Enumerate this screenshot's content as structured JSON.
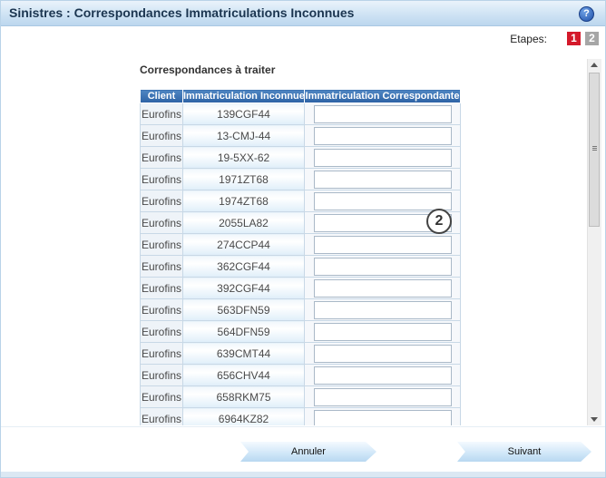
{
  "window": {
    "title": "Sinistres : Correspondances Immatriculations Inconnues",
    "help_icon": "?"
  },
  "steps": {
    "label": "Etapes:",
    "items": [
      {
        "label": "1",
        "color": "#d4192a"
      },
      {
        "label": "2",
        "color": "#a6a6a6"
      }
    ]
  },
  "section": {
    "title": "Correspondances à traiter"
  },
  "table": {
    "headers": [
      "Client",
      "Immatriculation Inconnue",
      "Immatriculation Correspondante"
    ],
    "rows": [
      {
        "client": "Eurofins",
        "plate": "139CGF44",
        "match": ""
      },
      {
        "client": "Eurofins",
        "plate": "13-CMJ-44",
        "match": ""
      },
      {
        "client": "Eurofins",
        "plate": "19-5XX-62",
        "match": ""
      },
      {
        "client": "Eurofins",
        "plate": "1971ZT68",
        "match": ""
      },
      {
        "client": "Eurofins",
        "plate": "1974ZT68",
        "match": ""
      },
      {
        "client": "Eurofins",
        "plate": "2055LA82",
        "match": ""
      },
      {
        "client": "Eurofins",
        "plate": "274CCP44",
        "match": ""
      },
      {
        "client": "Eurofins",
        "plate": "362CGF44",
        "match": ""
      },
      {
        "client": "Eurofins",
        "plate": "392CGF44",
        "match": ""
      },
      {
        "client": "Eurofins",
        "plate": "563DFN59",
        "match": ""
      },
      {
        "client": "Eurofins",
        "plate": "564DFN59",
        "match": ""
      },
      {
        "client": "Eurofins",
        "plate": "639CMT44",
        "match": ""
      },
      {
        "client": "Eurofins",
        "plate": "656CHV44",
        "match": ""
      },
      {
        "client": "Eurofins",
        "plate": "658RKM75",
        "match": ""
      },
      {
        "client": "Eurofins",
        "plate": "6964KZ82",
        "match": ""
      }
    ]
  },
  "badge": {
    "label": "2"
  },
  "buttons": {
    "cancel": "Annuler",
    "next": "Suivant"
  },
  "colors": {
    "accent": "#2d62a5",
    "title_bar": "#cfe3f4"
  }
}
